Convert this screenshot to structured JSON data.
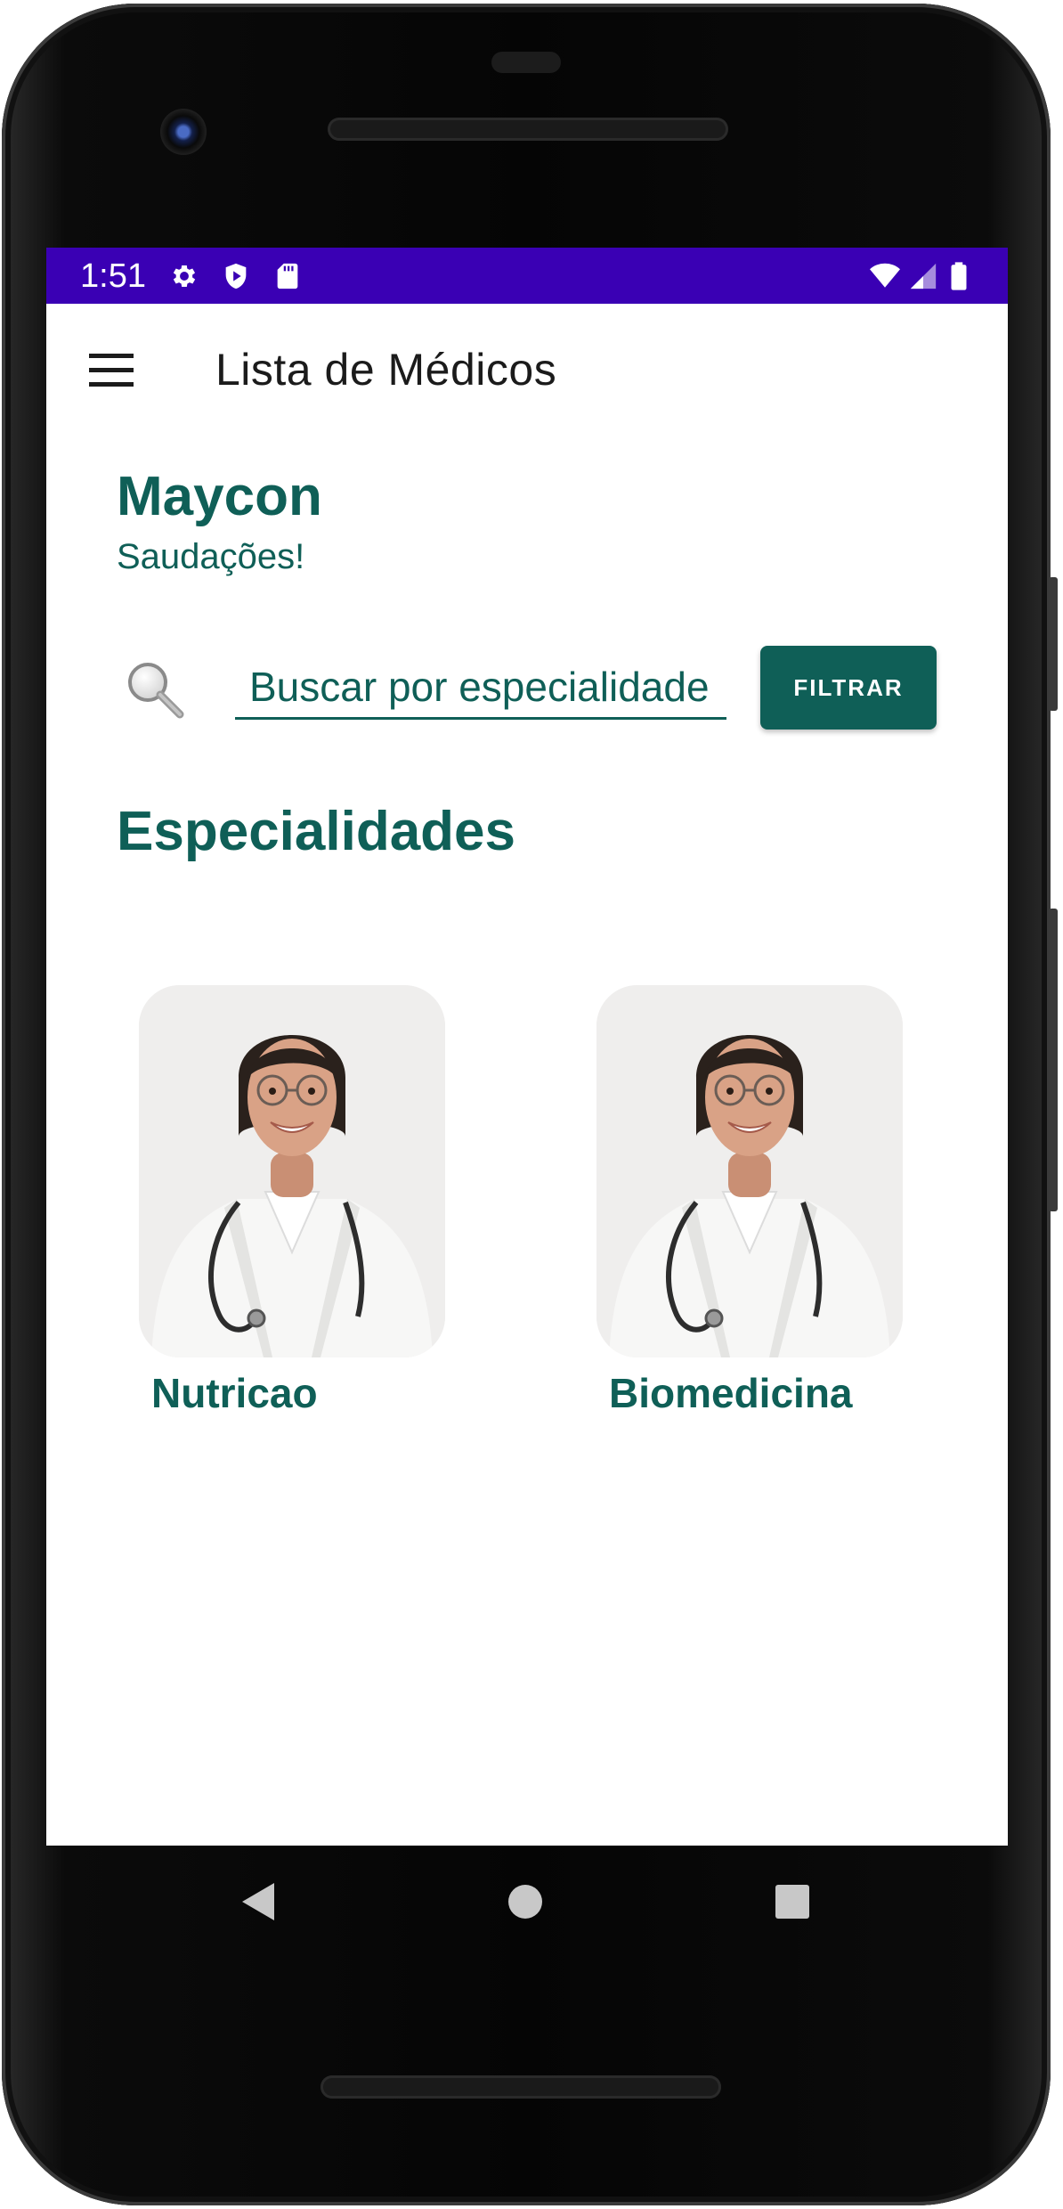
{
  "status_bar": {
    "time": "1:51",
    "left_icons": [
      "settings-icon",
      "shield-icon",
      "sd-card-icon"
    ],
    "right_icons": [
      "wifi-icon",
      "signal-icon",
      "battery-icon"
    ],
    "background": "#3a00b4"
  },
  "app_bar": {
    "title": "Lista de Médicos",
    "menu_icon": "hamburger-menu-icon"
  },
  "greeting": {
    "name": "Maycon",
    "subtitle": "Saudações!"
  },
  "search": {
    "placeholder": "Buscar por especialidade",
    "value": "",
    "icon": "search-icon",
    "button_label": "FILTRAR"
  },
  "section": {
    "title": "Especialidades"
  },
  "specialties": [
    {
      "label": "Nutricao"
    },
    {
      "label": "Biomedicina"
    }
  ],
  "navigation": {
    "buttons": [
      "back-icon",
      "home-icon",
      "recents-icon"
    ]
  },
  "theme": {
    "accent": "#0f5f57",
    "status_bar": "#3a00b4"
  }
}
